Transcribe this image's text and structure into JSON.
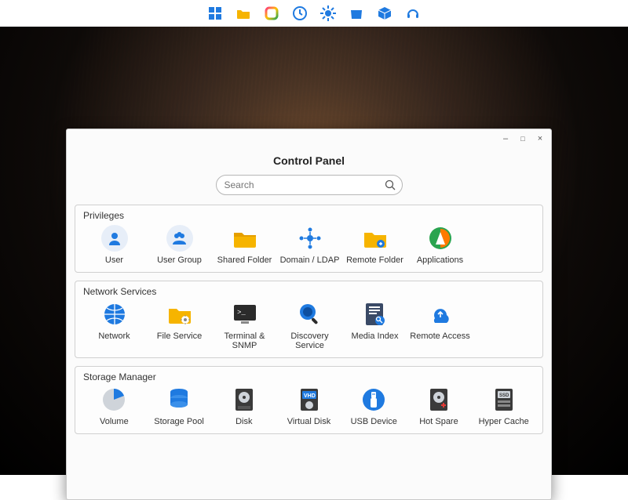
{
  "menubar": {
    "items": [
      {
        "name": "tiles-icon"
      },
      {
        "name": "folder-icon"
      },
      {
        "name": "photos-icon"
      },
      {
        "name": "clock-icon"
      },
      {
        "name": "settings-icon"
      },
      {
        "name": "store-icon"
      },
      {
        "name": "package-icon"
      },
      {
        "name": "headset-icon"
      }
    ]
  },
  "window": {
    "title": "Control Panel",
    "controls": {
      "minimize": "–",
      "maximize": "□",
      "close": "×"
    },
    "search": {
      "placeholder": "Search"
    }
  },
  "sections": [
    {
      "title": "Privileges",
      "items": [
        {
          "label": "User",
          "icon": "user-icon"
        },
        {
          "label": "User Group",
          "icon": "user-group-icon"
        },
        {
          "label": "Shared Folder",
          "icon": "shared-folder-icon"
        },
        {
          "label": "Domain / LDAP",
          "icon": "domain-ldap-icon"
        },
        {
          "label": "Remote Folder",
          "icon": "remote-folder-icon"
        },
        {
          "label": "Applications",
          "icon": "applications-icon"
        }
      ]
    },
    {
      "title": "Network Services",
      "items": [
        {
          "label": "Network",
          "icon": "network-icon"
        },
        {
          "label": "File Service",
          "icon": "file-service-icon"
        },
        {
          "label": "Terminal & SNMP",
          "icon": "terminal-snmp-icon"
        },
        {
          "label": "Discovery Service",
          "icon": "discovery-service-icon"
        },
        {
          "label": "Media Index",
          "icon": "media-index-icon"
        },
        {
          "label": "Remote Access",
          "icon": "remote-access-icon"
        }
      ]
    },
    {
      "title": "Storage Manager",
      "items": [
        {
          "label": "Volume",
          "icon": "volume-icon"
        },
        {
          "label": "Storage Pool",
          "icon": "storage-pool-icon"
        },
        {
          "label": "Disk",
          "icon": "disk-icon"
        },
        {
          "label": "Virtual Disk",
          "icon": "virtual-disk-icon"
        },
        {
          "label": "USB Device",
          "icon": "usb-device-icon"
        },
        {
          "label": "Hot Spare",
          "icon": "hot-spare-icon"
        },
        {
          "label": "Hyper Cache",
          "icon": "hyper-cache-icon"
        }
      ]
    }
  ],
  "colors": {
    "accent_blue": "#1f7ae0",
    "folder_yellow": "#f6b400",
    "dark": "#2b2b2b",
    "green": "#2aa44f",
    "orange": "#ff7a00"
  }
}
